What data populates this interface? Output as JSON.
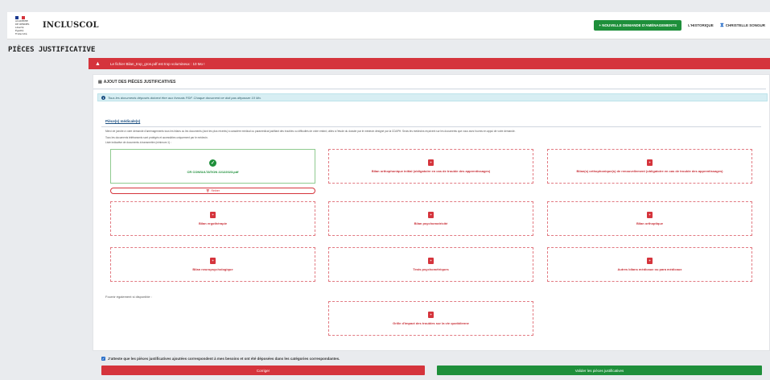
{
  "header": {
    "org_lines": [
      "ACADÉMIE",
      "DE RENNES",
      "Liberté",
      "Égalité",
      "Fraternité"
    ],
    "brand": "INCLUSCOL",
    "new_request_button": "+ NOUVELLE DEMANDE D'AMÉNAGEMENTS",
    "history_link": "L'HISTORIQUE",
    "user_name": "CHRISTELLE SONGUR",
    "colors": {
      "green": "#1e8f3a",
      "red": "#d5343c",
      "blue": "#1b4f82"
    }
  },
  "page": {
    "title": "PIÈCES JUSTIFICATIVE"
  },
  "alert": {
    "message": "Le fichier Bilan_trop_gros.pdf est trop volumineux : 10 Mo !"
  },
  "section": {
    "title": "AJOUT DES PIÈCES JUSTIFICATIVES",
    "info": "Tous les documents déposés doivent être aux formats PDF. Chaque document ne doit pas dépasser 10 Mo."
  },
  "medical": {
    "title": "Pièce(s) médicale(s)",
    "desc1": "Merci de joindre à votre demande d'aménagements tous les bilans ou les documents (dont les plus récents) à caractère médical ou paramédical justifiant des troubles ou difficultés de votre enfant, utiles à l'étude du dossier par le médecin désigné par la CDAPH. Seuls les médecins reçoivent sur les documents que vous avez fournis en appui de votre demande.",
    "desc2": "Tous les documents télétransmis sont protégés et accessibles uniquement par le médecin.",
    "desc3": "Liste indicative de documents à transmettre (minimum 1) :",
    "tiles": [
      {
        "label": "CR CONSULTATION 22122023.pdf",
        "uploaded": true,
        "icon": "check-icon"
      },
      {
        "label": "Bilan orthophonique initial (obligatoire en cas de trouble des apprentissages)",
        "uploaded": false,
        "icon": "pdf-icon"
      },
      {
        "label": "Bilan(s) orthophonique(s) de renouvellement (obligatoire en cas de trouble des apprentissages)",
        "uploaded": false,
        "icon": "pdf-icon"
      },
      {
        "label": "Bilan ergothérapie",
        "uploaded": false,
        "icon": "pdf-icon"
      },
      {
        "label": "Bilan psychomotricité",
        "uploaded": false,
        "icon": "pdf-icon"
      },
      {
        "label": "Bilan orthoptique",
        "uploaded": false,
        "icon": "pdf-icon"
      },
      {
        "label": "Bilan neuropsychologique",
        "uploaded": false,
        "icon": "pdf-icon"
      },
      {
        "label": "Tests psychométriques",
        "uploaded": false,
        "icon": "pdf-icon"
      },
      {
        "label": "Autres bilans médicaux ou para médicaux",
        "uploaded": false,
        "icon": "pdf-icon"
      }
    ],
    "remove_label": "Retirer",
    "also_label": "Fournir également si disponible :",
    "extra_tile": {
      "label": "Grille d'impact des troubles sur la vie quotidienne",
      "icon": "pdf-icon"
    }
  },
  "footer": {
    "attest": "J'atteste que les pièces justificatives ajoutées correspondent à mes besoins et ont été déposées dans les catégories correspondantes.",
    "correct_button": "Corriger",
    "validate_button": "Valider les pièces justificatives"
  }
}
